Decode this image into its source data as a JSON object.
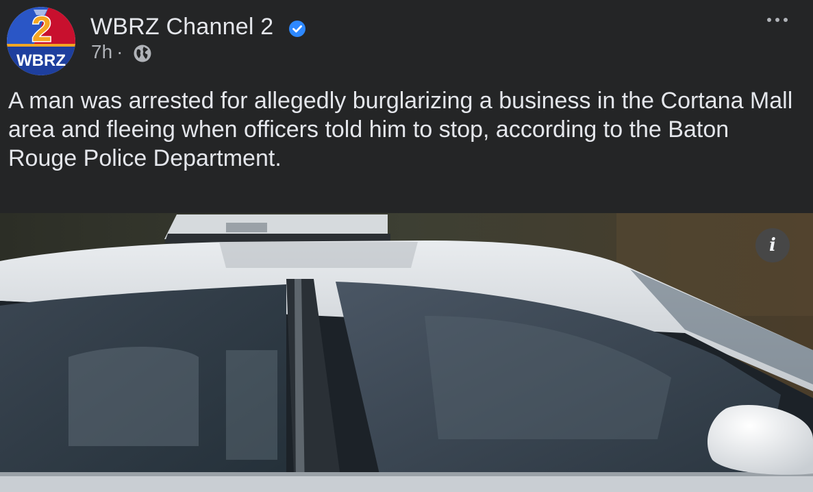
{
  "post": {
    "page_name": "WBRZ Channel 2",
    "timestamp": "7h",
    "separator": "·",
    "audience_icon": "globe-icon",
    "verified_icon": "verified-badge-icon",
    "more_icon": "more-options-icon",
    "text": "A man was arrested for allegedly burglarizing a business in the Cortana Mall area and fleeing when officers told him to stop, according to the Baton Rouge Police Department.",
    "avatar": {
      "logo_number": "2",
      "logo_text": "WBRZ"
    },
    "photo": {
      "info_button": "i",
      "info_icon": "info-icon"
    }
  },
  "colors": {
    "background": "#242526",
    "primary_text": "#e4e6eb",
    "secondary_text": "#b0b3b8",
    "verified_blue": "#2d88ff",
    "logo_red": "#c8102e",
    "logo_blue": "#1e3f9e",
    "logo_gold": "#f5a623"
  }
}
